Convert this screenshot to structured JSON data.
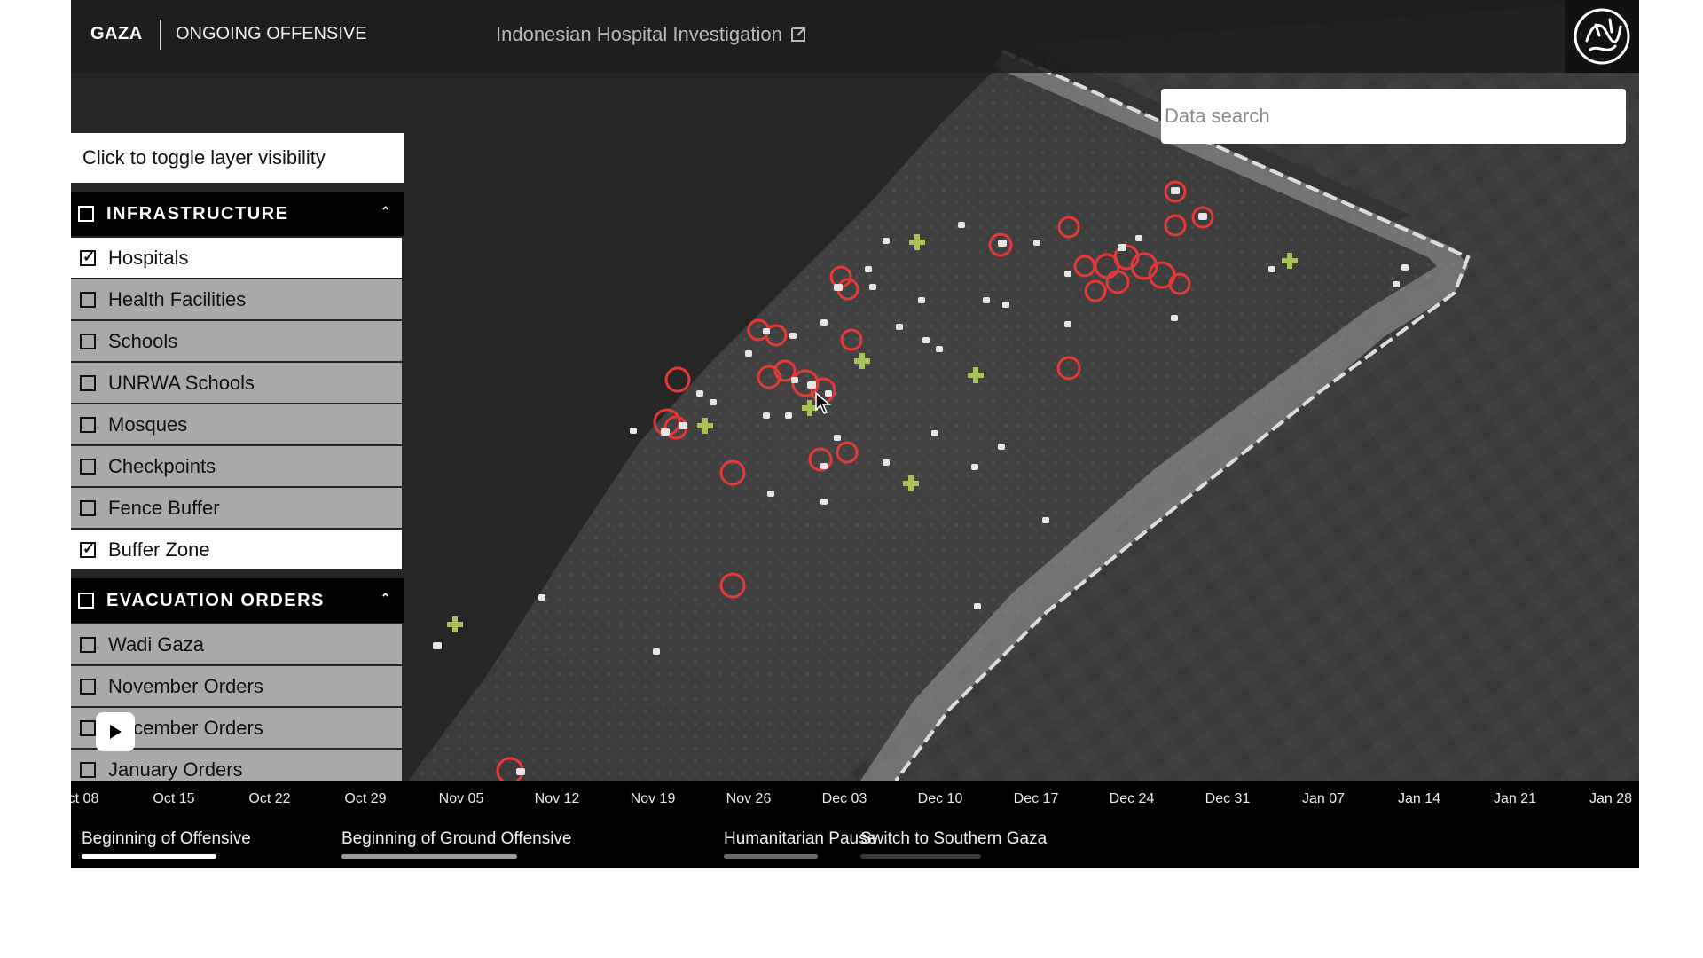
{
  "header": {
    "region": "GAZA",
    "status": "ONGOING OFFENSIVE",
    "investigation_link": "Indonesian Hospital Investigation",
    "logo_icon": "calligraphy-logo-icon"
  },
  "search": {
    "placeholder": "Data search",
    "value": ""
  },
  "layers": {
    "hint": "Click to toggle layer visibility",
    "groups": [
      {
        "title": "INFRASTRUCTURE",
        "checked": false,
        "items": [
          {
            "label": "Hospitals",
            "checked": true
          },
          {
            "label": "Health Facilities",
            "checked": false
          },
          {
            "label": "Schools",
            "checked": false
          },
          {
            "label": "UNRWA Schools",
            "checked": false
          },
          {
            "label": "Mosques",
            "checked": false
          },
          {
            "label": "Checkpoints",
            "checked": false
          },
          {
            "label": "Fence Buffer",
            "checked": false
          },
          {
            "label": "Buffer Zone",
            "checked": true
          }
        ]
      },
      {
        "title": "EVACUATION ORDERS",
        "checked": false,
        "items": [
          {
            "label": "Wadi Gaza",
            "checked": false
          },
          {
            "label": "November Orders",
            "checked": false
          },
          {
            "label": "December Orders",
            "checked": false
          },
          {
            "label": "January Orders",
            "checked": false
          }
        ]
      }
    ]
  },
  "timeline": {
    "ticks": [
      "ct 08",
      "Oct 15",
      "Oct 22",
      "Oct 29",
      "Nov 05",
      "Nov 12",
      "Nov 19",
      "Nov 26",
      "Dec 03",
      "Dec 10",
      "Dec 17",
      "Dec 24",
      "Dec 31",
      "Jan 07",
      "Jan 14",
      "Jan 21",
      "Jan 28"
    ],
    "events": [
      {
        "label": "Beginning of Offensive",
        "highlight": "#ffffff"
      },
      {
        "label": "Beginning of Ground Offensive",
        "highlight": "#9a9a9a"
      },
      {
        "label": "Humanitarian Pause",
        "highlight": "#6a6a6a"
      },
      {
        "label": "Switch to Southern Gaza",
        "highlight": "#3a3a3a"
      }
    ]
  },
  "colors": {
    "incident_ring": "#e53935",
    "hospital_marker": "#a8c256",
    "buffer_zone": "#a0a0a0",
    "sea": "#262626"
  },
  "map_icons": [
    "camera-icon",
    "hospital-cross-icon",
    "cursor-icon"
  ]
}
